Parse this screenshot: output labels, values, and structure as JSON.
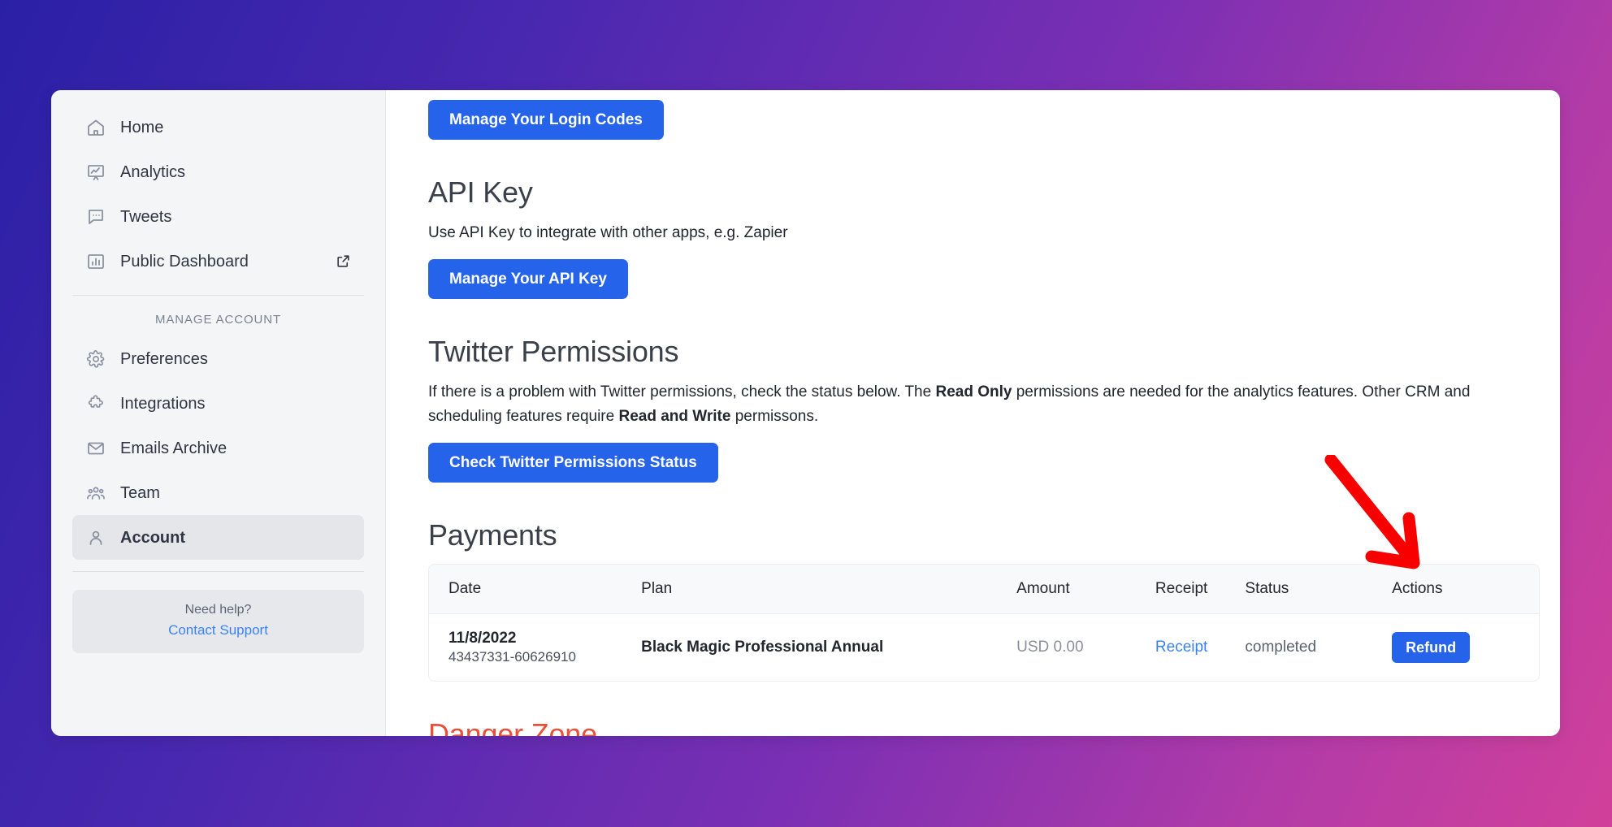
{
  "sidebar": {
    "primary_items": [
      {
        "label": "Home",
        "icon": "home-icon",
        "external": false
      },
      {
        "label": "Analytics",
        "icon": "analytics-icon",
        "external": false
      },
      {
        "label": "Tweets",
        "icon": "tweets-icon",
        "external": false
      },
      {
        "label": "Public Dashboard",
        "icon": "bar-chart-icon",
        "external": true
      }
    ],
    "section_label": "MANAGE ACCOUNT",
    "account_items": [
      {
        "label": "Preferences",
        "icon": "gear-icon",
        "active": false
      },
      {
        "label": "Integrations",
        "icon": "puzzle-icon",
        "active": false
      },
      {
        "label": "Emails Archive",
        "icon": "envelope-icon",
        "active": false
      },
      {
        "label": "Team",
        "icon": "people-icon",
        "active": false
      },
      {
        "label": "Account",
        "icon": "user-icon",
        "active": true
      }
    ],
    "help": {
      "title": "Need help?",
      "link_label": "Contact Support"
    }
  },
  "main": {
    "login_codes_button": "Manage Your Login Codes",
    "api_key": {
      "heading": "API Key",
      "description": "Use API Key to integrate with other apps, e.g. Zapier",
      "button": "Manage Your API Key"
    },
    "twitter_permissions": {
      "heading": "Twitter Permissions",
      "text_part1": "If there is a problem with Twitter permissions, check the status below. The ",
      "bold1": "Read Only",
      "text_part2": " permissions are needed for the analytics features. Other CRM and scheduling features require ",
      "bold2": "Read and Write",
      "text_part3": " permissons.",
      "button": "Check Twitter Permissions Status"
    },
    "payments": {
      "heading": "Payments",
      "columns": [
        "Date",
        "Plan",
        "Amount",
        "Receipt",
        "Status",
        "Actions"
      ],
      "rows": [
        {
          "date": "11/8/2022",
          "transaction_id": "43437331-60626910",
          "plan": "Black Magic Professional Annual",
          "amount": "USD 0.00",
          "receipt_label": "Receipt",
          "status": "completed",
          "action_label": "Refund"
        }
      ]
    },
    "danger_zone": {
      "heading": "Danger Zone"
    }
  },
  "colors": {
    "accent_blue": "#2563eb",
    "link_blue": "#3b82f6",
    "danger_red": "#e8503a",
    "annotation_red": "#f90000",
    "bg_gradient_start": "#2a20a6",
    "bg_gradient_end": "#d1409a"
  }
}
